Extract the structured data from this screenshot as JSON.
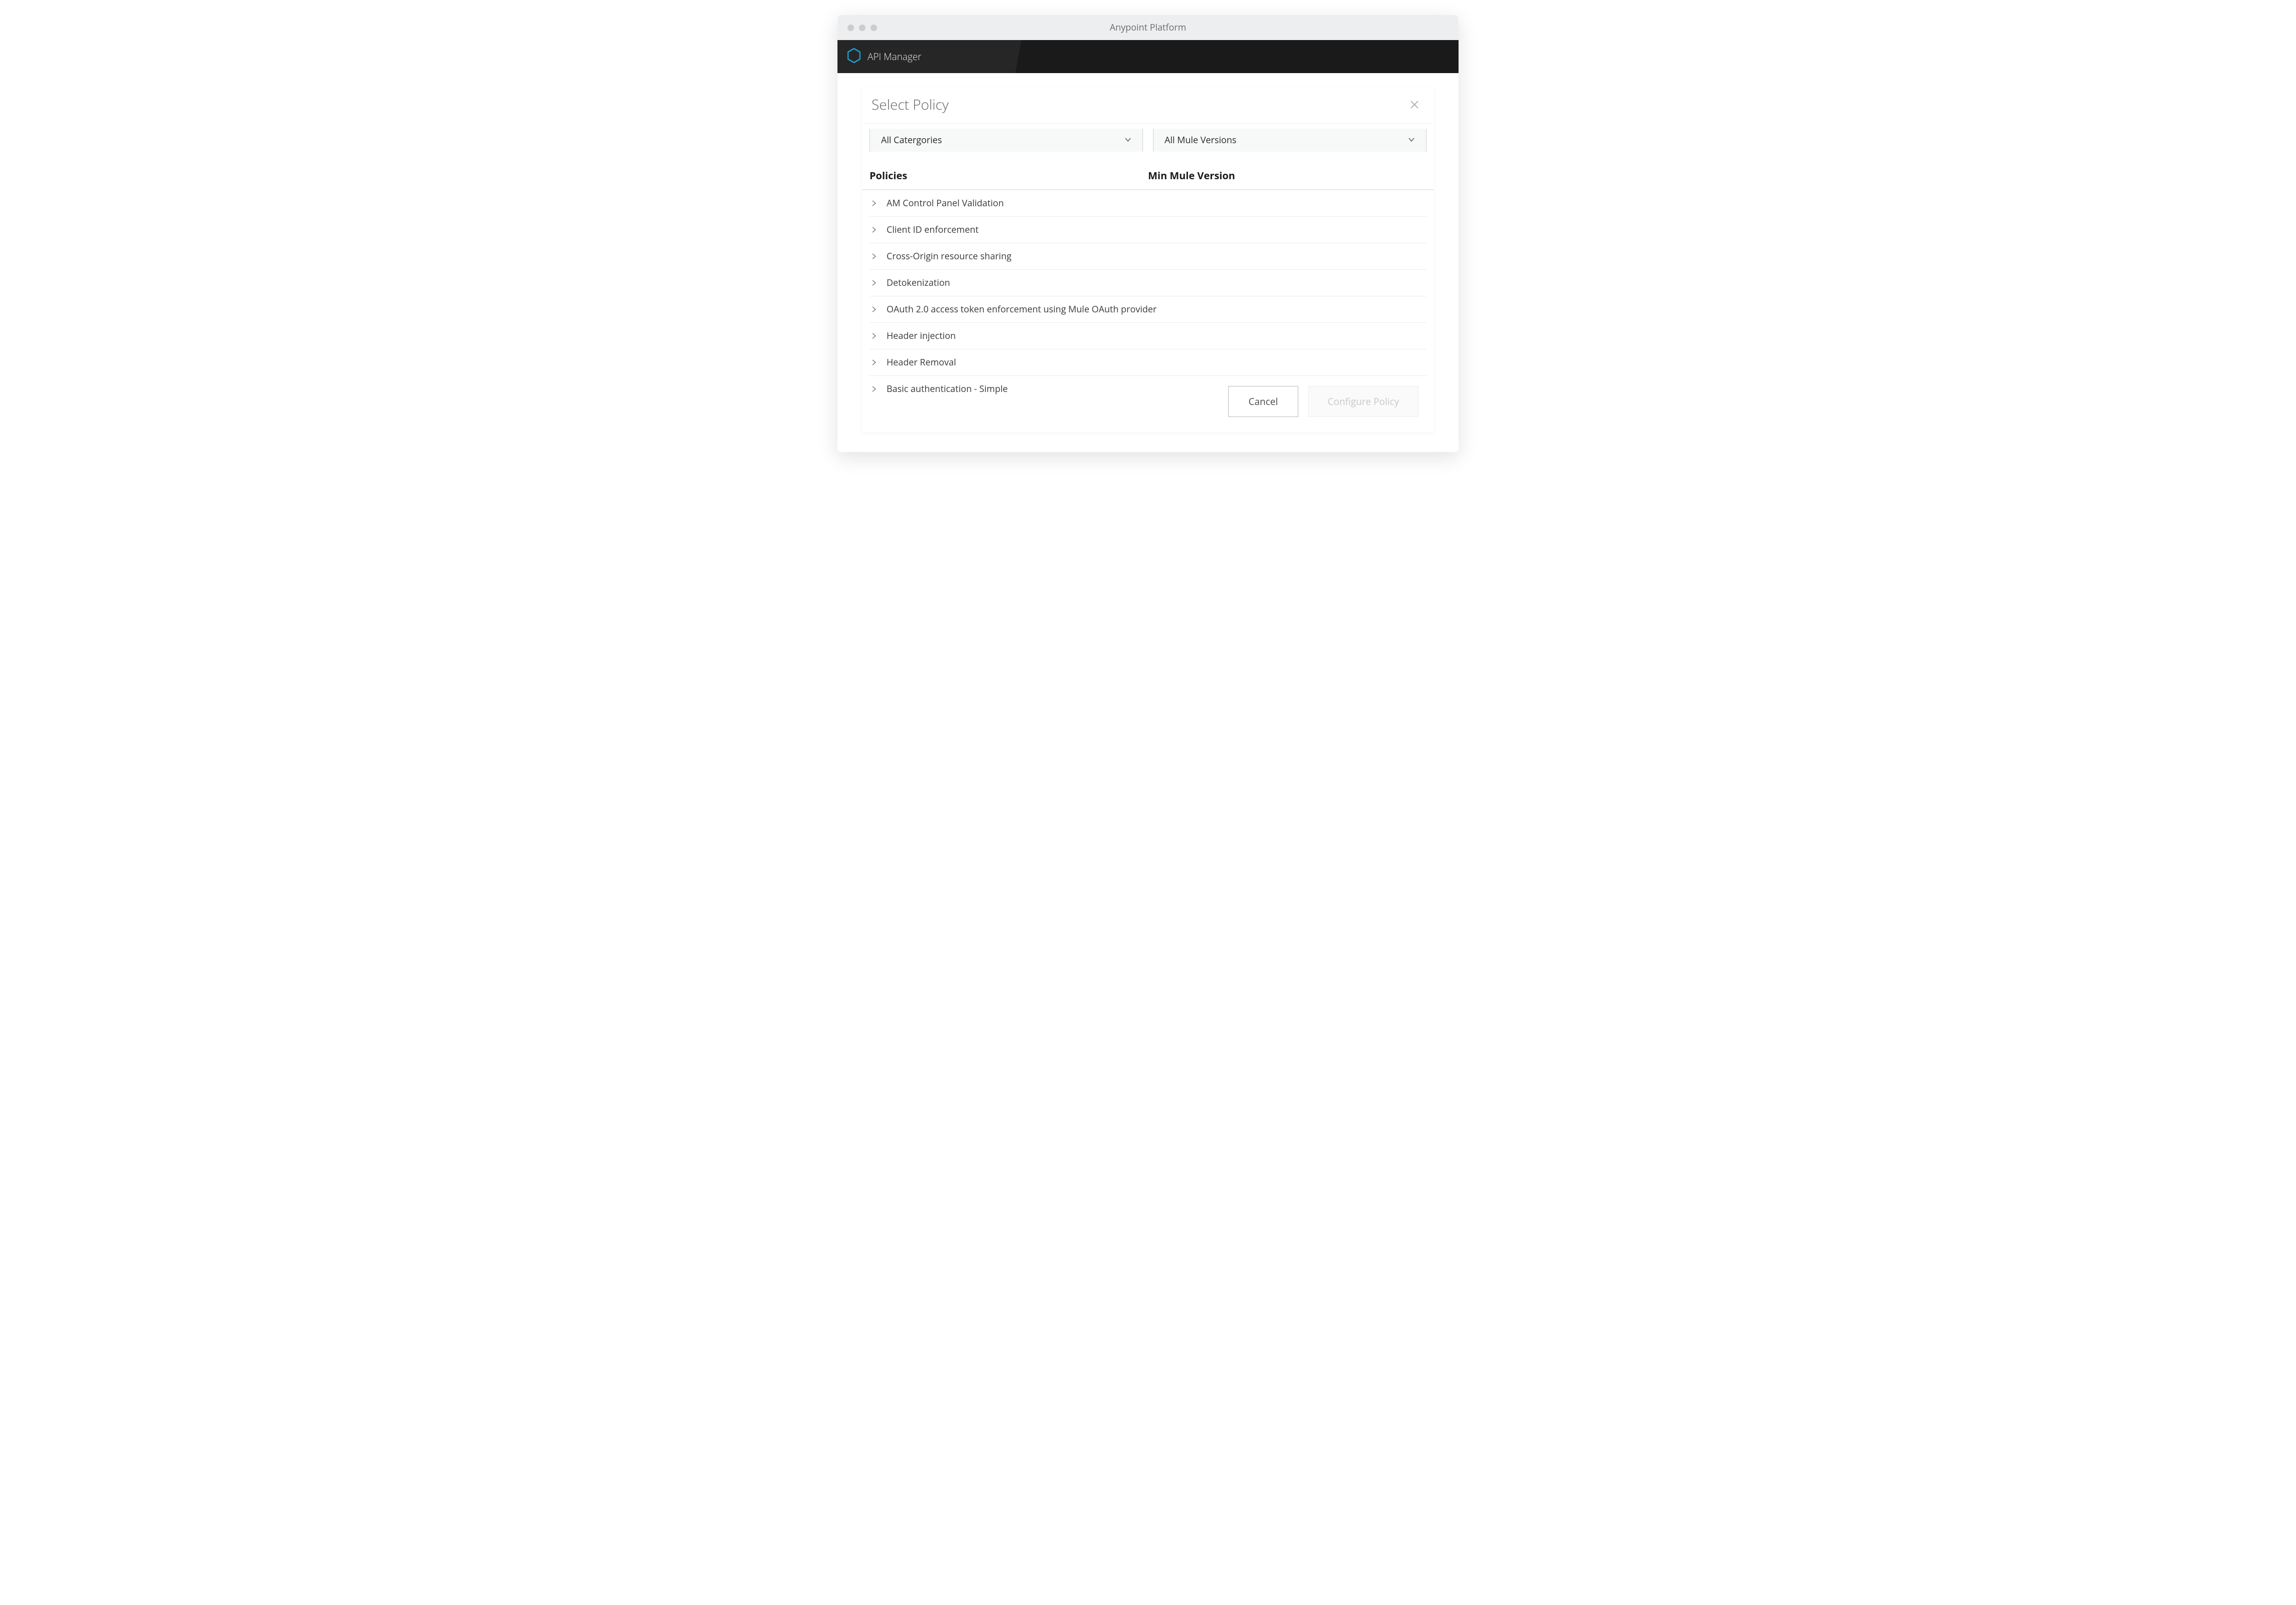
{
  "window": {
    "title": "Anypoint Platform"
  },
  "header": {
    "title": "API Manager"
  },
  "panel": {
    "title": "Select Policy",
    "filters": {
      "category": "All Catergories",
      "version": "All Mule Versions"
    },
    "columns": {
      "policies": "Policies",
      "minVersion": "Min Mule Version"
    },
    "policies": [
      {
        "label": "AM Control Panel Validation"
      },
      {
        "label": "Client ID enforcement"
      },
      {
        "label": "Cross-Origin resource sharing"
      },
      {
        "label": "Detokenization"
      },
      {
        "label": "OAuth 2.0 access token enforcement using Mule OAuth provider"
      },
      {
        "label": "Header injection"
      },
      {
        "label": "Header  Removal"
      },
      {
        "label": "Basic authentication - Simple"
      }
    ],
    "actions": {
      "cancel": "Cancel",
      "configure": "Configure Policy"
    }
  }
}
